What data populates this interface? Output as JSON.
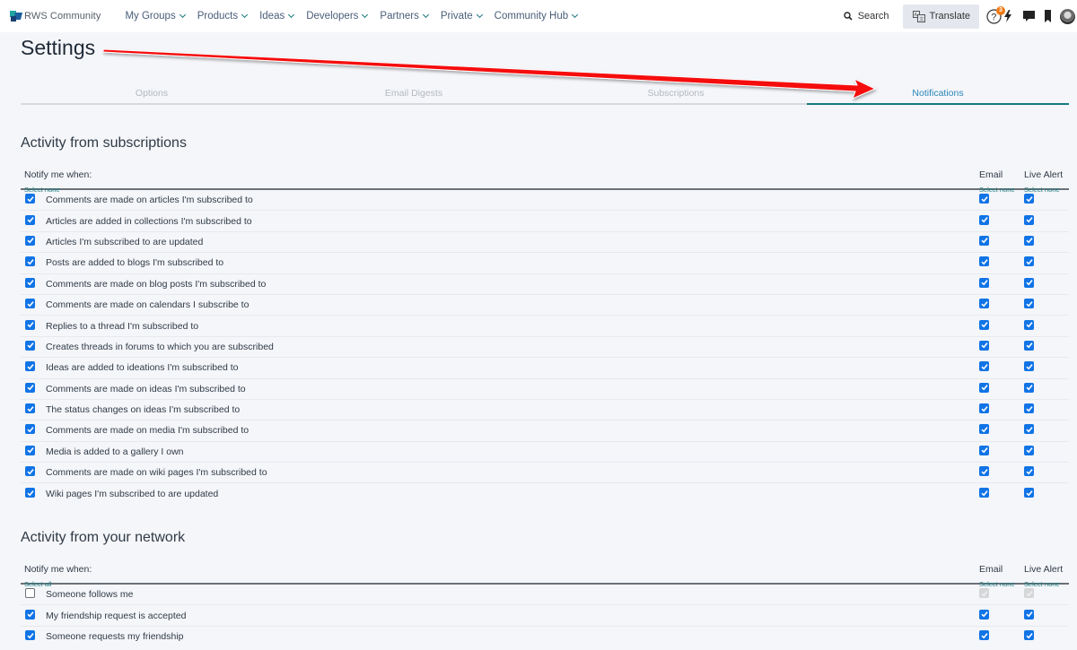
{
  "header": {
    "logo_text": "RWS Community",
    "nav": [
      {
        "label": "My Groups"
      },
      {
        "label": "Products"
      },
      {
        "label": "Ideas"
      },
      {
        "label": "Developers"
      },
      {
        "label": "Partners"
      },
      {
        "label": "Private"
      },
      {
        "label": "Community Hub"
      }
    ],
    "search_label": "Search",
    "translate_label": "Translate",
    "notification_count": "3",
    "icons": [
      "help-icon",
      "activity-bolt-icon",
      "messages-icon",
      "bookmark-icon",
      "user-avatar"
    ]
  },
  "page": {
    "title": "Settings"
  },
  "tabs": [
    {
      "label": "Options",
      "active": false
    },
    {
      "label": "Email Digests",
      "active": false
    },
    {
      "label": "Subscriptions",
      "active": false
    },
    {
      "label": "Notifications",
      "active": true
    }
  ],
  "colors": {
    "accent_teal": "#16797d",
    "active_tab_text": "#2a86b7",
    "checkbox_blue": "#1174e6",
    "badge_orange": "#f07a17",
    "annotation_arrow": "#ff0000"
  },
  "sections": [
    {
      "title": "Activity from subscriptions",
      "notify_label": "Notify me when:",
      "select_link": "Select none",
      "email_label": "Email",
      "email_select": "Select none",
      "live_label": "Live Alert",
      "live_select": "Select none",
      "rows": [
        {
          "label": "Comments are made on articles I'm subscribed to",
          "enabled": true,
          "email": true,
          "live": true
        },
        {
          "label": "Articles are added in collections I'm subscribed to",
          "enabled": true,
          "email": true,
          "live": true
        },
        {
          "label": "Articles I'm subscribed to are updated",
          "enabled": true,
          "email": true,
          "live": true
        },
        {
          "label": "Posts are added to blogs I'm subscribed to",
          "enabled": true,
          "email": true,
          "live": true
        },
        {
          "label": "Comments are made on blog posts I'm subscribed to",
          "enabled": true,
          "email": true,
          "live": true
        },
        {
          "label": "Comments are made on calendars I subscribe to",
          "enabled": true,
          "email": true,
          "live": true
        },
        {
          "label": "Replies to a thread I'm subscribed to",
          "enabled": true,
          "email": true,
          "live": true
        },
        {
          "label": "Creates threads in forums to which you are subscribed",
          "enabled": true,
          "email": true,
          "live": true
        },
        {
          "label": "Ideas are added to ideations I'm subscribed to",
          "enabled": true,
          "email": true,
          "live": true
        },
        {
          "label": "Comments are made on ideas I'm subscribed to",
          "enabled": true,
          "email": true,
          "live": true
        },
        {
          "label": "The status changes on ideas I'm subscribed to",
          "enabled": true,
          "email": true,
          "live": true
        },
        {
          "label": "Comments are made on media I'm subscribed to",
          "enabled": true,
          "email": true,
          "live": true
        },
        {
          "label": "Media is added to a gallery I own",
          "enabled": true,
          "email": true,
          "live": true
        },
        {
          "label": "Comments are made on wiki pages I'm subscribed to",
          "enabled": true,
          "email": true,
          "live": true
        },
        {
          "label": "Wiki pages I'm subscribed to are updated",
          "enabled": true,
          "email": true,
          "live": true
        }
      ]
    },
    {
      "title": "Activity from your network",
      "notify_label": "Notify me when:",
      "select_link": "Select all",
      "email_label": "Email",
      "email_select": "Select none",
      "live_label": "Live Alert",
      "live_select": "Select none",
      "rows": [
        {
          "label": "Someone follows me",
          "enabled": false,
          "email": true,
          "live": true
        },
        {
          "label": "My friendship request is accepted",
          "enabled": true,
          "email": true,
          "live": true
        },
        {
          "label": "Someone requests my friendship",
          "enabled": true,
          "email": true,
          "live": true
        }
      ]
    }
  ]
}
